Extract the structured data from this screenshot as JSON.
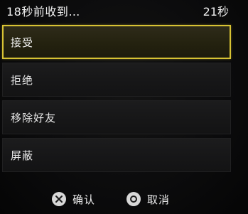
{
  "header": {
    "message": "18秒前收到…",
    "timer": "21秒"
  },
  "menu": {
    "items": [
      {
        "label": "接受",
        "selected": true
      },
      {
        "label": "拒绝",
        "selected": false
      },
      {
        "label": "移除好友",
        "selected": false
      },
      {
        "label": "屏蔽",
        "selected": false
      }
    ]
  },
  "footer": {
    "confirm": {
      "icon": "cross-button-icon",
      "label": "确认"
    },
    "cancel": {
      "icon": "circle-button-icon",
      "label": "取消"
    }
  },
  "colors": {
    "highlight": "#d7c234",
    "background": "#0b0b0c"
  }
}
